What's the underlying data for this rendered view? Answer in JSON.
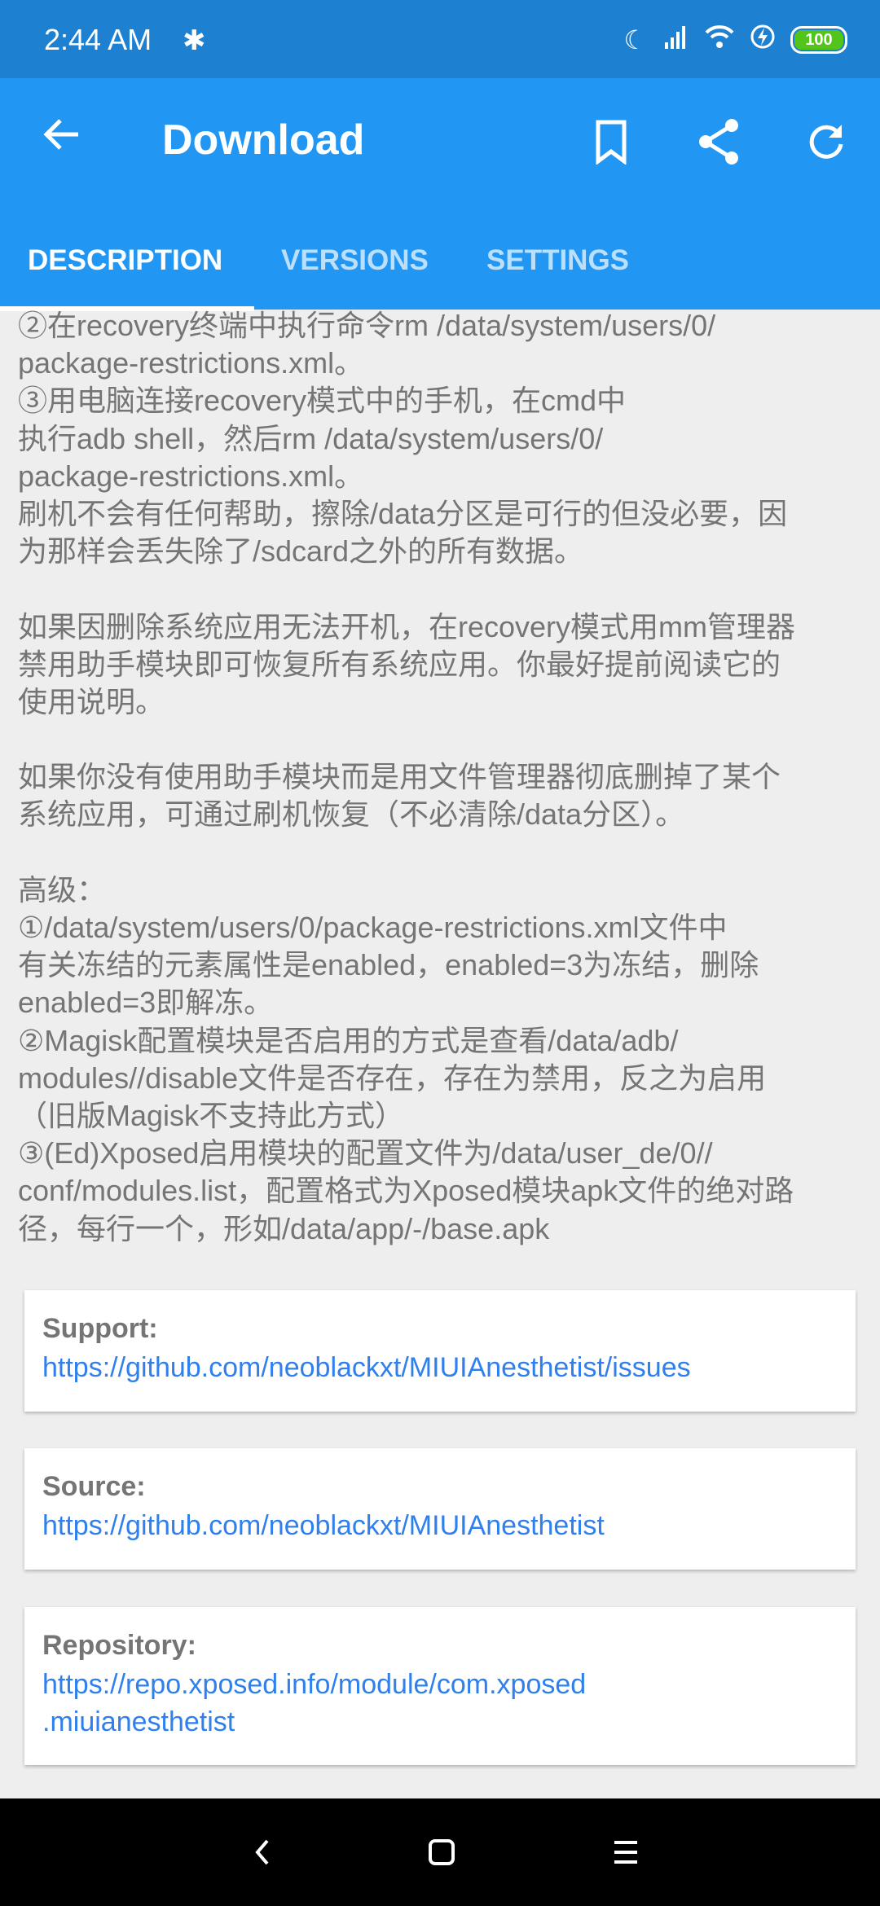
{
  "status_bar": {
    "time": "2:44 AM",
    "battery": "100",
    "icons": [
      "puzzle-icon",
      "moon-icon",
      "signal-icon",
      "wifi-icon",
      "charging-icon",
      "battery-icon"
    ]
  },
  "app_bar": {
    "title": "Download",
    "icons": [
      "back-arrow-icon",
      "bookmark-icon",
      "share-icon",
      "refresh-icon"
    ]
  },
  "tabs": [
    {
      "label": "DESCRIPTION",
      "active": true
    },
    {
      "label": "VERSIONS",
      "active": false
    },
    {
      "label": "SETTINGS",
      "active": false
    }
  ],
  "description_lines": [
    "②在recovery终端中执行命令rm /data/system/users/0/",
    "package-restrictions.xml。",
    "③用电脑连接recovery模式中的手机，在cmd中",
    "执行adb shell，然后rm /data/system/users/0/",
    "package-restrictions.xml。",
    "刷机不会有任何帮助，擦除/data分区是可行的但没必要，因",
    "为那样会丢失除了/sdcard之外的所有数据。",
    "",
    "如果因删除系统应用无法开机，在recovery模式用mm管理器",
    "禁用助手模块即可恢复所有系统应用。你最好提前阅读它的",
    "使用说明。",
    "",
    "如果你没有使用助手模块而是用文件管理器彻底删掉了某个",
    "系统应用，可通过刷机恢复（不必清除/data分区）。",
    "",
    "高级：",
    "①/data/system/users/0/package-restrictions.xml文件中",
    "有关冻结的元素属性是enabled，enabled=3为冻结，删除",
    "enabled=3即解冻。",
    "②Magisk配置模块是否启用的方式是查看/data/adb/",
    "modules//disable文件是否存在，存在为禁用，反之为启用",
    "（旧版Magisk不支持此方式）",
    "③(Ed)Xposed启用模块的配置文件为/data/user_de/0//",
    "conf/modules.list，配置格式为Xposed模块apk文件的绝对路",
    "径，每行一个，形如/data/app/-/base.apk"
  ],
  "cards": {
    "support": {
      "label": "Support:",
      "links": [
        "https://github.com/neoblackxt/MIUIAnesthetist/issues"
      ]
    },
    "source": {
      "label": "Source:",
      "links": [
        "https://github.com/neoblackxt/MIUIAnesthetist"
      ]
    },
    "repository": {
      "label": "Repository:",
      "links": [
        "https://repo.xposed.info/module/com.xposed",
        ".miuianesthetist"
      ]
    }
  },
  "colors": {
    "status_bar": "#1e80d0",
    "primary": "#2196f3",
    "link": "#2f80ed",
    "text": "#757575",
    "background": "#eeeeee"
  }
}
